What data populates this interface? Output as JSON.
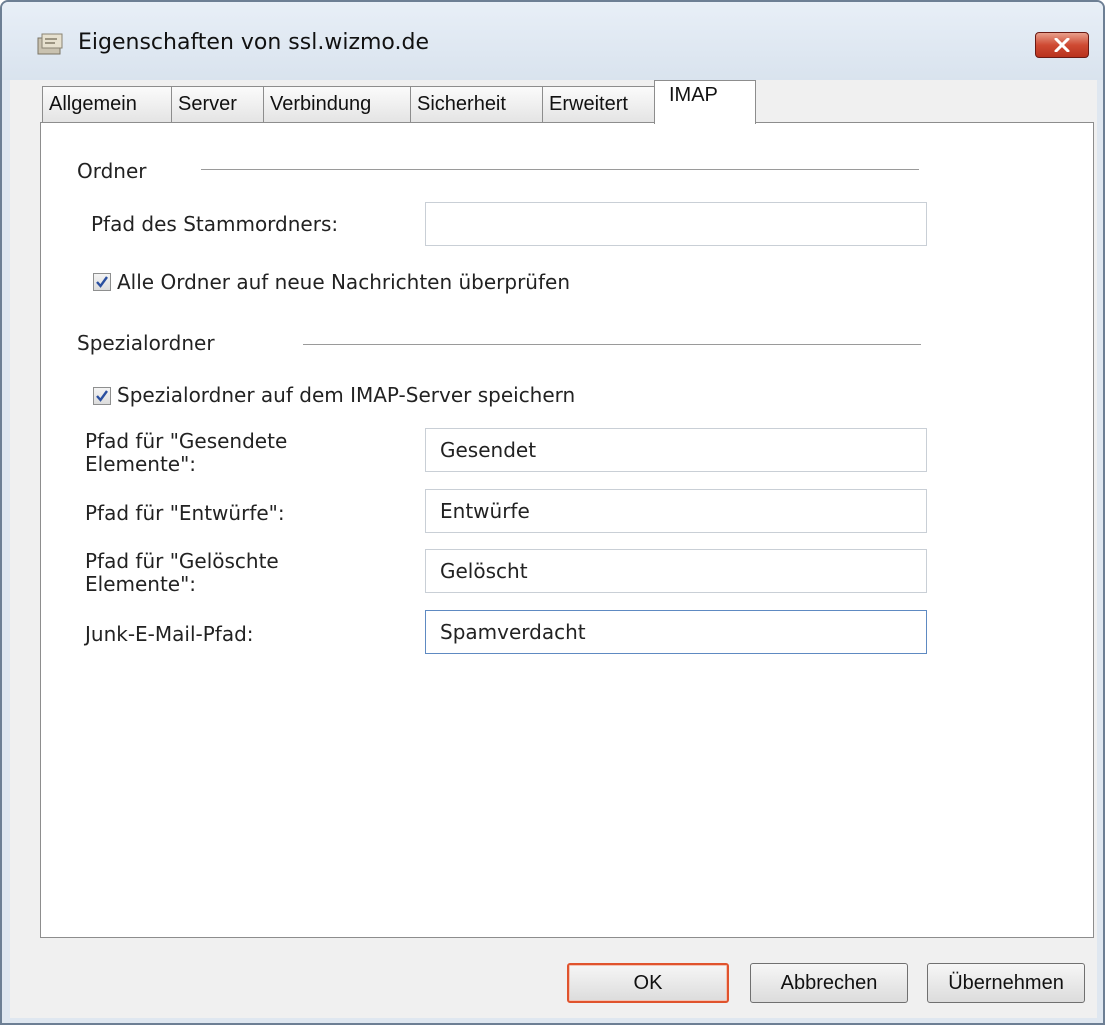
{
  "window": {
    "title": "Eigenschaften von ssl.wizmo.de"
  },
  "tabs": [
    {
      "label": "Allgemein",
      "active": false
    },
    {
      "label": "Server",
      "active": false
    },
    {
      "label": "Verbindung",
      "active": false
    },
    {
      "label": "Sicherheit",
      "active": false
    },
    {
      "label": "Erweitert",
      "active": false
    },
    {
      "label": "IMAP",
      "active": true
    }
  ],
  "folders": {
    "heading": "Ordner",
    "root_path_label": "Pfad des Stammordners:",
    "root_path_value": "",
    "check_all_label": "Alle Ordner auf neue Nachrichten überprüfen",
    "check_all_checked": true
  },
  "special": {
    "heading": "Spezialordner",
    "store_on_server_label": "Spezialordner auf dem IMAP-Server speichern",
    "store_on_server_checked": true,
    "sent_label_1": "Pfad für \"Gesendete",
    "sent_label_2": "Elemente\":",
    "sent_value": "Gesendet",
    "drafts_label": "Pfad für \"Entwürfe\":",
    "drafts_value": "Entwürfe",
    "deleted_label_1": "Pfad für \"Gelöschte",
    "deleted_label_2": "Elemente\":",
    "deleted_value": "Gelöscht",
    "junk_label": "Junk-E-Mail-Pfad:",
    "junk_value": "Spamverdacht"
  },
  "buttons": {
    "ok": "OK",
    "cancel": "Abbrechen",
    "apply": "Übernehmen"
  },
  "colors": {
    "default_button_border": "#e0532d",
    "close_button": "#cf4a33",
    "check": "#2a4fa0"
  }
}
